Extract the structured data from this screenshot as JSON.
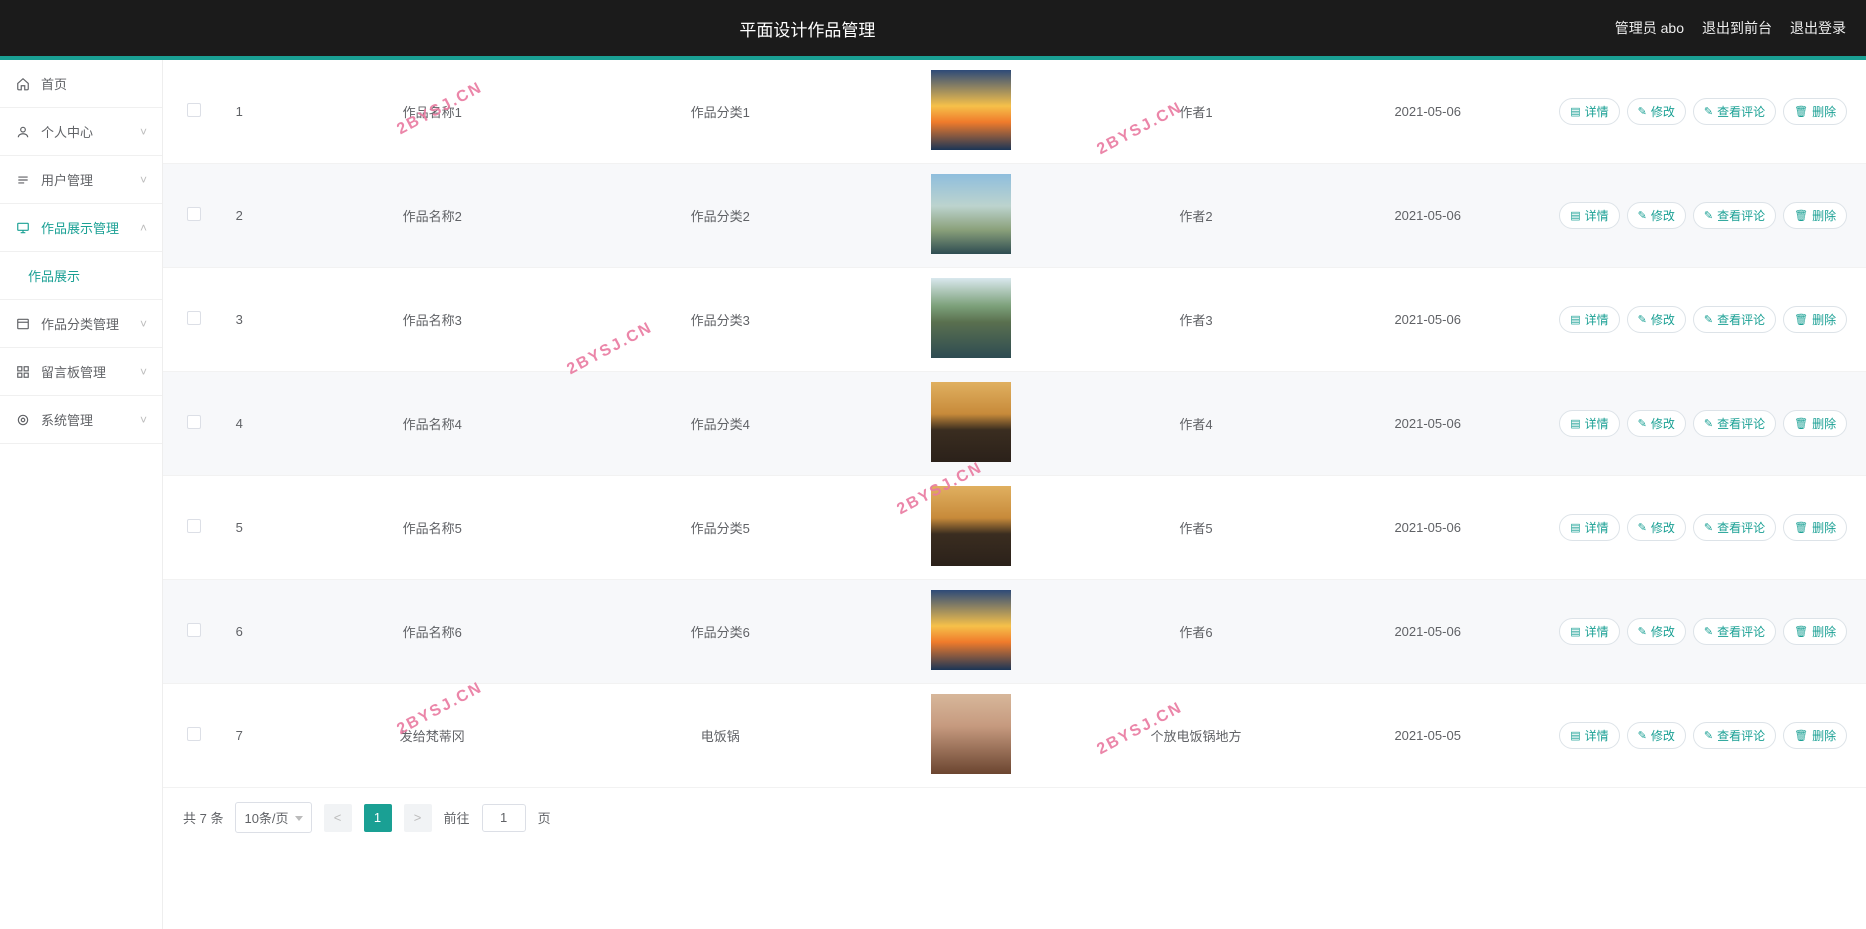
{
  "header": {
    "title": "平面设计作品管理",
    "admin_label": "管理员 abo",
    "exit_front": "退出到前台",
    "logout": "退出登录"
  },
  "sidebar": {
    "items": [
      {
        "icon": "home-icon",
        "label": "首页",
        "expandable": false
      },
      {
        "icon": "user-icon",
        "label": "个人中心",
        "expandable": true,
        "open": false
      },
      {
        "icon": "user-manage-icon",
        "label": "用户管理",
        "expandable": true,
        "open": false
      },
      {
        "icon": "display-icon",
        "label": "作品展示管理",
        "expandable": true,
        "open": true,
        "active": true,
        "children": [
          {
            "label": "作品展示"
          }
        ]
      },
      {
        "icon": "category-icon",
        "label": "作品分类管理",
        "expandable": true,
        "open": false
      },
      {
        "icon": "board-icon",
        "label": "留言板管理",
        "expandable": true,
        "open": false
      },
      {
        "icon": "system-icon",
        "label": "系统管理",
        "expandable": true,
        "open": false
      }
    ]
  },
  "actions": {
    "details": "详情",
    "edit": "修改",
    "comments": "查看评论",
    "delete": "删除"
  },
  "rows": [
    {
      "index": "1",
      "name": "作品名称1",
      "category": "作品分类1",
      "author": "作者1",
      "date": "2021-05-06",
      "thumb": "th-a"
    },
    {
      "index": "2",
      "name": "作品名称2",
      "category": "作品分类2",
      "author": "作者2",
      "date": "2021-05-06",
      "thumb": "th-b"
    },
    {
      "index": "3",
      "name": "作品名称3",
      "category": "作品分类3",
      "author": "作者3",
      "date": "2021-05-06",
      "thumb": "th-c"
    },
    {
      "index": "4",
      "name": "作品名称4",
      "category": "作品分类4",
      "author": "作者4",
      "date": "2021-05-06",
      "thumb": "th-d"
    },
    {
      "index": "5",
      "name": "作品名称5",
      "category": "作品分类5",
      "author": "作者5",
      "date": "2021-05-06",
      "thumb": "th-e"
    },
    {
      "index": "6",
      "name": "作品名称6",
      "category": "作品分类6",
      "author": "作者6",
      "date": "2021-05-06",
      "thumb": "th-f"
    },
    {
      "index": "7",
      "name": "发给梵蒂冈",
      "category": "电饭锅",
      "author": "个放电饭锅地方",
      "date": "2021-05-05",
      "thumb": "th-g"
    }
  ],
  "pagination": {
    "total_text": "共 7 条",
    "page_size_label": "10条/页",
    "current_page": "1",
    "prev_symbol": "<",
    "next_symbol": ">",
    "goto_prefix": "前往",
    "goto_value": "1",
    "goto_suffix": "页"
  },
  "watermark": "2BYSJ.CN"
}
